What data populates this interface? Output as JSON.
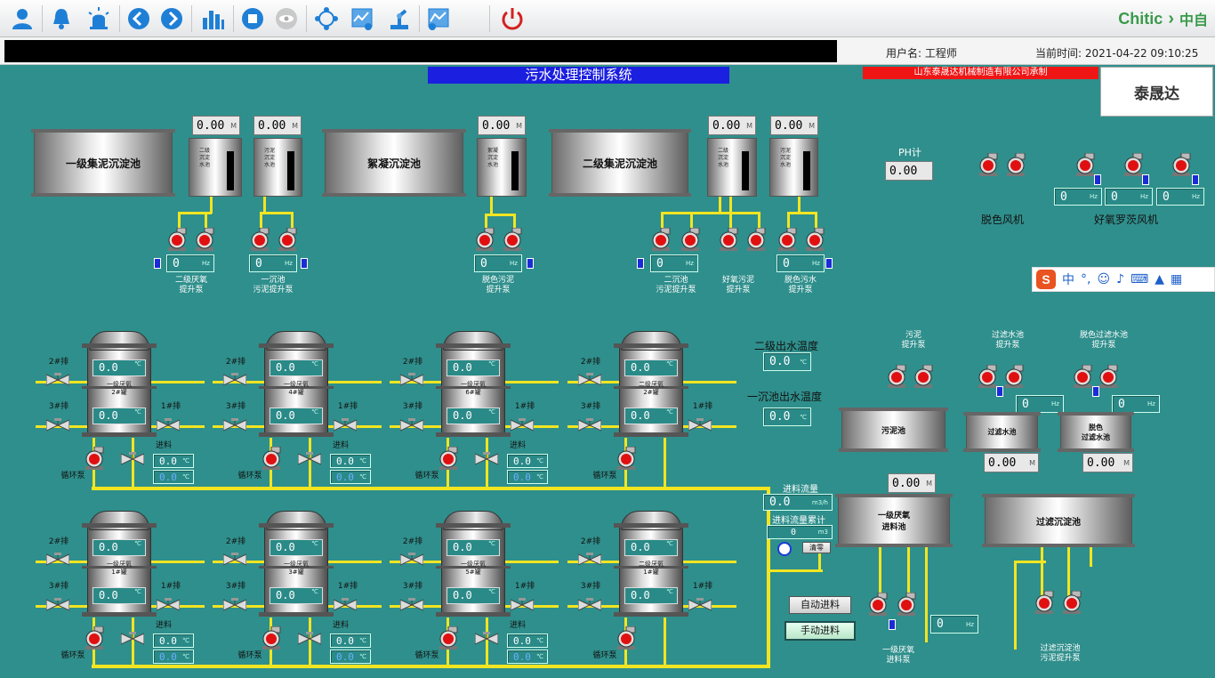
{
  "toolbar": {
    "icons": [
      "user-icon",
      "alarm-bell-icon",
      "alert-light-icon",
      "back-arrow-icon",
      "forward-arrow-icon",
      "bar-chart-icon",
      "stop-icon",
      "view-icon",
      "network-icon",
      "settings-chart-icon",
      "robot-arm-icon",
      "config-chart-icon",
      "power-icon"
    ]
  },
  "brand": {
    "en": "Chitic",
    "cn": "中自"
  },
  "info": {
    "user_label": "用户名:",
    "user_value": "工程师",
    "time_label": "当前时间:",
    "time_value": "2021-04-22 09:10:25"
  },
  "title": "污水处理控制系统",
  "maker": "山东泰晟达机械制造有限公司承制",
  "logo": "泰晟达",
  "units": {
    "m": "M",
    "hz": "Hz",
    "c": "℃",
    "m3h": "m3/h",
    "m3": "m3"
  },
  "top_tanks": {
    "t1": "一级集泥沉淀池",
    "t2": "絮凝沉淀池",
    "t3": "二级集泥沉淀池",
    "v1": "二级沉淀水池",
    "v2": "污泥沉淀水池",
    "v3": "絮凝沉淀水池",
    "v4": "二级沉淀水池",
    "v5": "污泥沉淀水池"
  },
  "levels": {
    "l1": "0.00",
    "l2": "0.00",
    "l3": "0.00",
    "l4": "0.00",
    "l5": "0.00",
    "mid1": "0.00",
    "mid2": "0.00",
    "r1": "0.00",
    "r2": "0.00",
    "r3": "0.00"
  },
  "pump_freq": {
    "f1": "0",
    "f2": "0",
    "f3": "0",
    "f4": "0",
    "f5": "0",
    "fa": "0",
    "fb": "0",
    "fc": "0",
    "fd": "0",
    "fe": "0",
    "ff": "0"
  },
  "pump_labels": {
    "p1": "二级厌氧\n提升泵",
    "p2": "一沉池\n污泥提升泵",
    "p3": "脱色污泥\n提升泵",
    "p4": "二沉池\n污泥提升泵",
    "p5": "好氧污泥\n提升泵",
    "p6": "脱色污水\n提升泵",
    "sludge": "污泥\n提升泵",
    "filt": "过滤水池\n提升泵",
    "decol": "脱色过滤水池\n提升泵",
    "feedpump": "一级厌氧\n进料泵",
    "settlepump": "过滤沉淀池\n污泥提升泵"
  },
  "ph": {
    "label": "PH计",
    "value": "0.00"
  },
  "blowers": {
    "decolor": "脱色风机",
    "aerobic": "好氧罗茨风机"
  },
  "temps": {
    "t2_label": "二级出水温度",
    "t2_value": "0.0",
    "t1_label": "一沉池出水温度",
    "t1_value": "0.0"
  },
  "right_tanks": {
    "sludge": "污泥池",
    "filt": "过滤水池",
    "decol": "脱色\n过滤水池",
    "feed": "一级厌氧\n进料池",
    "settle": "过滤沉淀池"
  },
  "reactors": [
    {
      "name": "一级厌氧\n2#罐",
      "t_top": "0.0",
      "t_bot": "0.0"
    },
    {
      "name": "一级厌氧\n4#罐",
      "t_top": "0.0",
      "t_bot": "0.0"
    },
    {
      "name": "一级厌氧\n6#罐",
      "t_top": "0.0",
      "t_bot": "0.0"
    },
    {
      "name": "二级厌氧\n2#罐",
      "t_top": "0.0",
      "t_bot": "0.0"
    },
    {
      "name": "一级厌氧\n1#罐",
      "t_top": "0.0",
      "t_bot": "0.0"
    },
    {
      "name": "一级厌氧\n3#罐",
      "t_top": "0.0",
      "t_bot": "0.0"
    },
    {
      "name": "一级厌氧\n5#罐",
      "t_top": "0.0",
      "t_bot": "0.0"
    },
    {
      "name": "二级厌氧\n1#罐",
      "t_top": "0.0",
      "t_bot": "0.0"
    }
  ],
  "valve_labels": {
    "v2": "2#排",
    "v3": "3#排",
    "v1": "1#排"
  },
  "feed_label": "进料",
  "circ_label": "循环泵",
  "feed_vals": {
    "a": "0.0",
    "b": "0.0"
  },
  "flow": {
    "rate_label": "进料流量",
    "rate_value": "0.0",
    "total_label": "进料流量累计",
    "total_value": "0",
    "clear": "清零"
  },
  "buttons": {
    "auto": "自动进料",
    "manual": "手动进料"
  },
  "ime": {
    "lang": "中",
    "extra": "°,"
  }
}
